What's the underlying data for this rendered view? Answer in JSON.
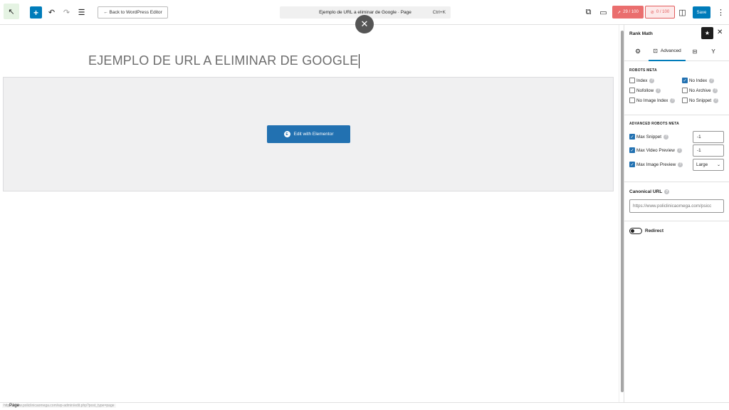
{
  "toolbar": {
    "logo_icon": "arrow-up-left-icon",
    "add_icon": "plus-icon",
    "back_label": "← Back to WordPress Editor",
    "command": {
      "title": "Ejemplo de URL a eliminar de Google · Page",
      "shortcut": "Ctrl+K"
    },
    "score1": "29 / 100",
    "score2": "0 / 100",
    "save_label": "Save"
  },
  "canvas": {
    "post_title": "EJEMPLO DE URL A ELIMINAR DE GOOGLE",
    "elementor_button": "Edit with Elementor"
  },
  "sidebar": {
    "title": "Rank Math",
    "tabs": {
      "advanced": "Advanced"
    },
    "robots_meta": {
      "label": "ROBOTS META",
      "items": [
        {
          "label": "Index",
          "checked": false
        },
        {
          "label": "No Index",
          "checked": true
        },
        {
          "label": "Nofollow",
          "checked": false
        },
        {
          "label": "No Archive",
          "checked": false
        },
        {
          "label": "No Image Index",
          "checked": false
        },
        {
          "label": "No Snippet",
          "checked": false
        }
      ]
    },
    "advanced_robots_meta": {
      "label": "ADVANCED ROBOTS META",
      "max_snippet": {
        "label": "Max Snippet",
        "value": "-1"
      },
      "max_video_preview": {
        "label": "Max Video Preview",
        "value": "-1"
      },
      "max_image_preview": {
        "label": "Max Image Preview",
        "value": "Large"
      }
    },
    "canonical": {
      "label": "Canonical URL",
      "value": "https://www.policlinicaomega.com/psicc"
    },
    "redirect": {
      "label": "Redirect"
    }
  },
  "footer": {
    "status_url": "https://www.policlinicaomega.com/wp-admin/edit.php?post_type=page",
    "page_label": "Page"
  }
}
